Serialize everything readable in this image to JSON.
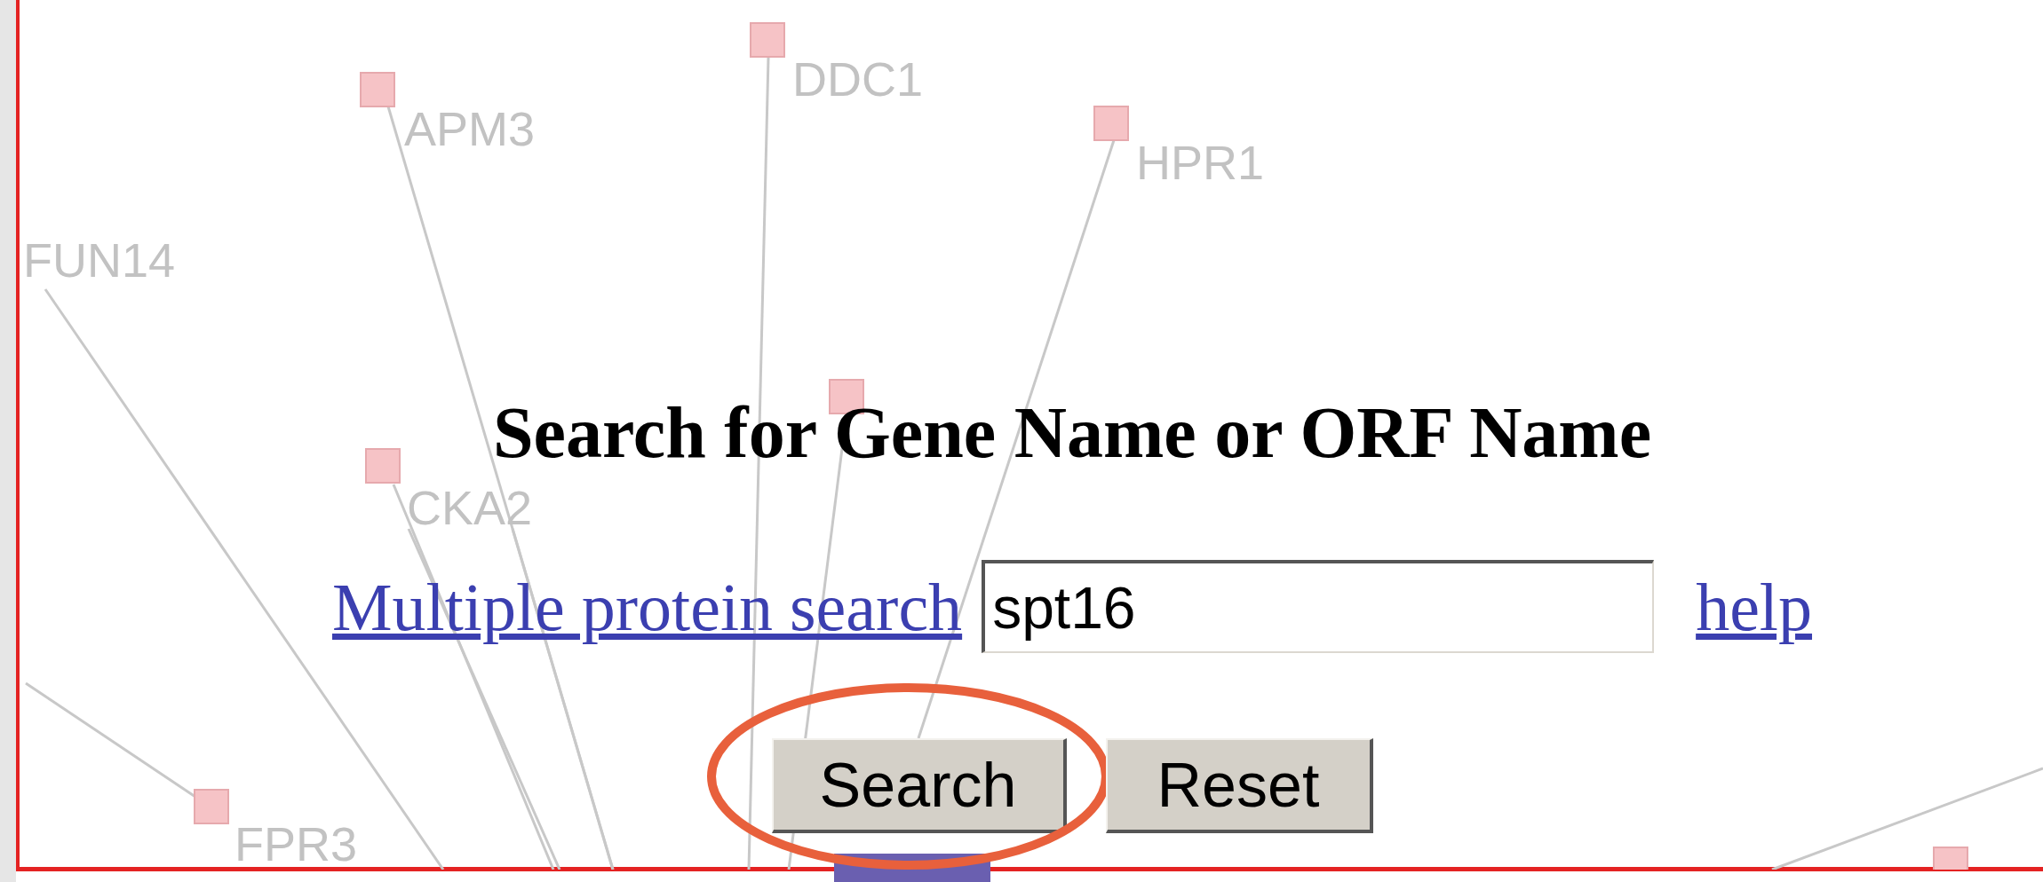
{
  "network": {
    "nodes": [
      {
        "label": "APM3"
      },
      {
        "label": "DDC1"
      },
      {
        "label": "HPR1"
      },
      {
        "label": "FUN14"
      },
      {
        "label": "CKA2"
      },
      {
        "label": "FPR3"
      }
    ]
  },
  "search_form": {
    "heading": "Search for Gene Name or ORF Name",
    "multiple_search_link": "Multiple protein search",
    "query_field": {
      "value": "spt16"
    },
    "help_link": "help",
    "buttons": [
      {
        "label": "Search",
        "highlighted": true
      },
      {
        "label": "Reset",
        "highlighted": false
      }
    ]
  }
}
